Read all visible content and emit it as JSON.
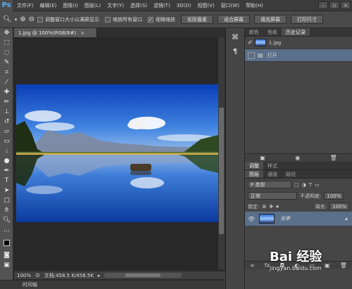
{
  "menubar": {
    "logo": "Ps",
    "items": [
      "文件(F)",
      "编辑(E)",
      "图像(I)",
      "图层(L)",
      "文字(Y)",
      "选择(S)",
      "滤镜(T)",
      "3D(D)",
      "视图(V)",
      "窗口(W)",
      "帮助(H)"
    ]
  },
  "options": {
    "check1_label": "调整窗口大小以满屏显示",
    "check2_label": "缩放所有窗口",
    "check3_label": "细微缩放",
    "btn_actual": "实际像素",
    "btn_fit": "适合屏幕",
    "btn_fill": "填充屏幕",
    "btn_print": "打印尺寸"
  },
  "document": {
    "tab_label": "1.jpg @ 100%(RGB/8#)",
    "close": "×"
  },
  "status": {
    "zoom": "100%",
    "doc_info": "文档:458.5 K/458.5K"
  },
  "timeline": {
    "label": "时间轴"
  },
  "history_panel": {
    "tabs": [
      "颜色",
      "色板",
      "历史记录"
    ],
    "snapshot_label": "1.jpg",
    "open_label": "打开"
  },
  "adjust_panel": {
    "tabs": [
      "调整",
      "样式"
    ]
  },
  "layers_panel": {
    "tabs": [
      "图层",
      "通道",
      "路径"
    ],
    "filter_label": "P 类型",
    "blend_mode": "正常",
    "opacity_label": "不透明度:",
    "opacity_value": "100%",
    "lock_label": "锁定:",
    "fill_label": "填充:",
    "fill_value": "100%",
    "layer_name": "背景"
  },
  "watermark": {
    "logo": "Bai 经验",
    "url": "jingyan.baidu.com"
  }
}
